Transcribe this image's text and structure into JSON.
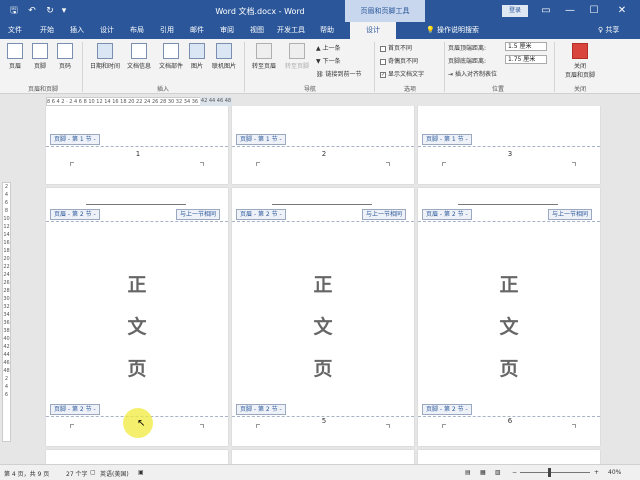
{
  "titlebar": {
    "title": "Word 文档.docx - Word",
    "context_tools": "页眉和页脚工具",
    "login": "登录",
    "qa_save": "🖫",
    "qa_undo": "↶",
    "qa_redo": "↻",
    "qa_more": "▾",
    "win_restore": "▭",
    "win_min": "—",
    "win_max": "☐",
    "win_close": "✕"
  },
  "tabs": [
    {
      "label": "文件"
    },
    {
      "label": "开始"
    },
    {
      "label": "插入"
    },
    {
      "label": "设计"
    },
    {
      "label": "布局"
    },
    {
      "label": "引用"
    },
    {
      "label": "邮件"
    },
    {
      "label": "审阅"
    },
    {
      "label": "视图"
    },
    {
      "label": "开发工具"
    },
    {
      "label": "帮助"
    },
    {
      "label": "设计"
    }
  ],
  "search": "💡 操作说明搜索",
  "share": "♀ 共享",
  "ribbon": {
    "header": "页眉",
    "footer": "页脚",
    "pagenum": "页码",
    "group_hf": "页眉和页脚",
    "datetime": "日期和时间",
    "docinfo": "文档信息",
    "docparts": "文档部件",
    "picture": "图片",
    "online_picture": "联机图片",
    "group_insert": "插入",
    "goto_header": "转至页眉",
    "goto_footer": "转至页脚",
    "prev": "上一条",
    "next": "下一条",
    "link_prev": "链接到前一节",
    "group_nav": "导航",
    "diff_first": "首页不同",
    "diff_odd_even": "奇偶页不同",
    "show_text": "显示文档文字",
    "group_options": "选项",
    "header_top": "页眉顶端距离:",
    "header_top_val": "1.5 厘米",
    "footer_bottom": "页脚底端距离:",
    "footer_bottom_val": "1.75 厘米",
    "insert_align_tab": "插入对齐制表位",
    "group_position": "位置",
    "close": "关闭\n页眉和页脚",
    "group_close": "关闭",
    "check_mark": "✓"
  },
  "hruler": "8  6  4  2  ·  2  4  6  8  10 12 14 16 18 20 22 24 26 28 30 32 34 36 38",
  "hruler_end": "42 44 46 48",
  "vruler_ticks": [
    "2",
    "4",
    "6",
    "8",
    "10",
    "12",
    "14",
    "16",
    "18",
    "20",
    "22",
    "24",
    "26",
    "28",
    "30",
    "32",
    "34",
    "36",
    "38",
    "40",
    "42",
    "44",
    "46",
    "48",
    "2",
    "4",
    "6"
  ],
  "tags": {
    "footer1": "页脚 - 第 1 节 -",
    "header2": "页眉 - 第 2 节 -",
    "footer2": "页脚 - 第 2 节 -",
    "same_as_prev": "与上一节相同"
  },
  "pages_top": [
    {
      "num": "1"
    },
    {
      "num": "2"
    },
    {
      "num": "3"
    }
  ],
  "pages_mid": [
    {
      "num": ""
    },
    {
      "num": "5"
    },
    {
      "num": "6"
    }
  ],
  "body_chars": [
    "正",
    "文",
    "页"
  ],
  "cursor": "↖",
  "status": {
    "page": "第 4 页，共 9 页",
    "words": "27 个字",
    "lang_icon": "▢",
    "lang": "英语(美国)",
    "macro_icon": "▣",
    "view_read": "▤",
    "view_print": "▦",
    "view_web": "▧",
    "zoom_minus": "−",
    "zoom_plus": "+",
    "zoom": "40%"
  }
}
